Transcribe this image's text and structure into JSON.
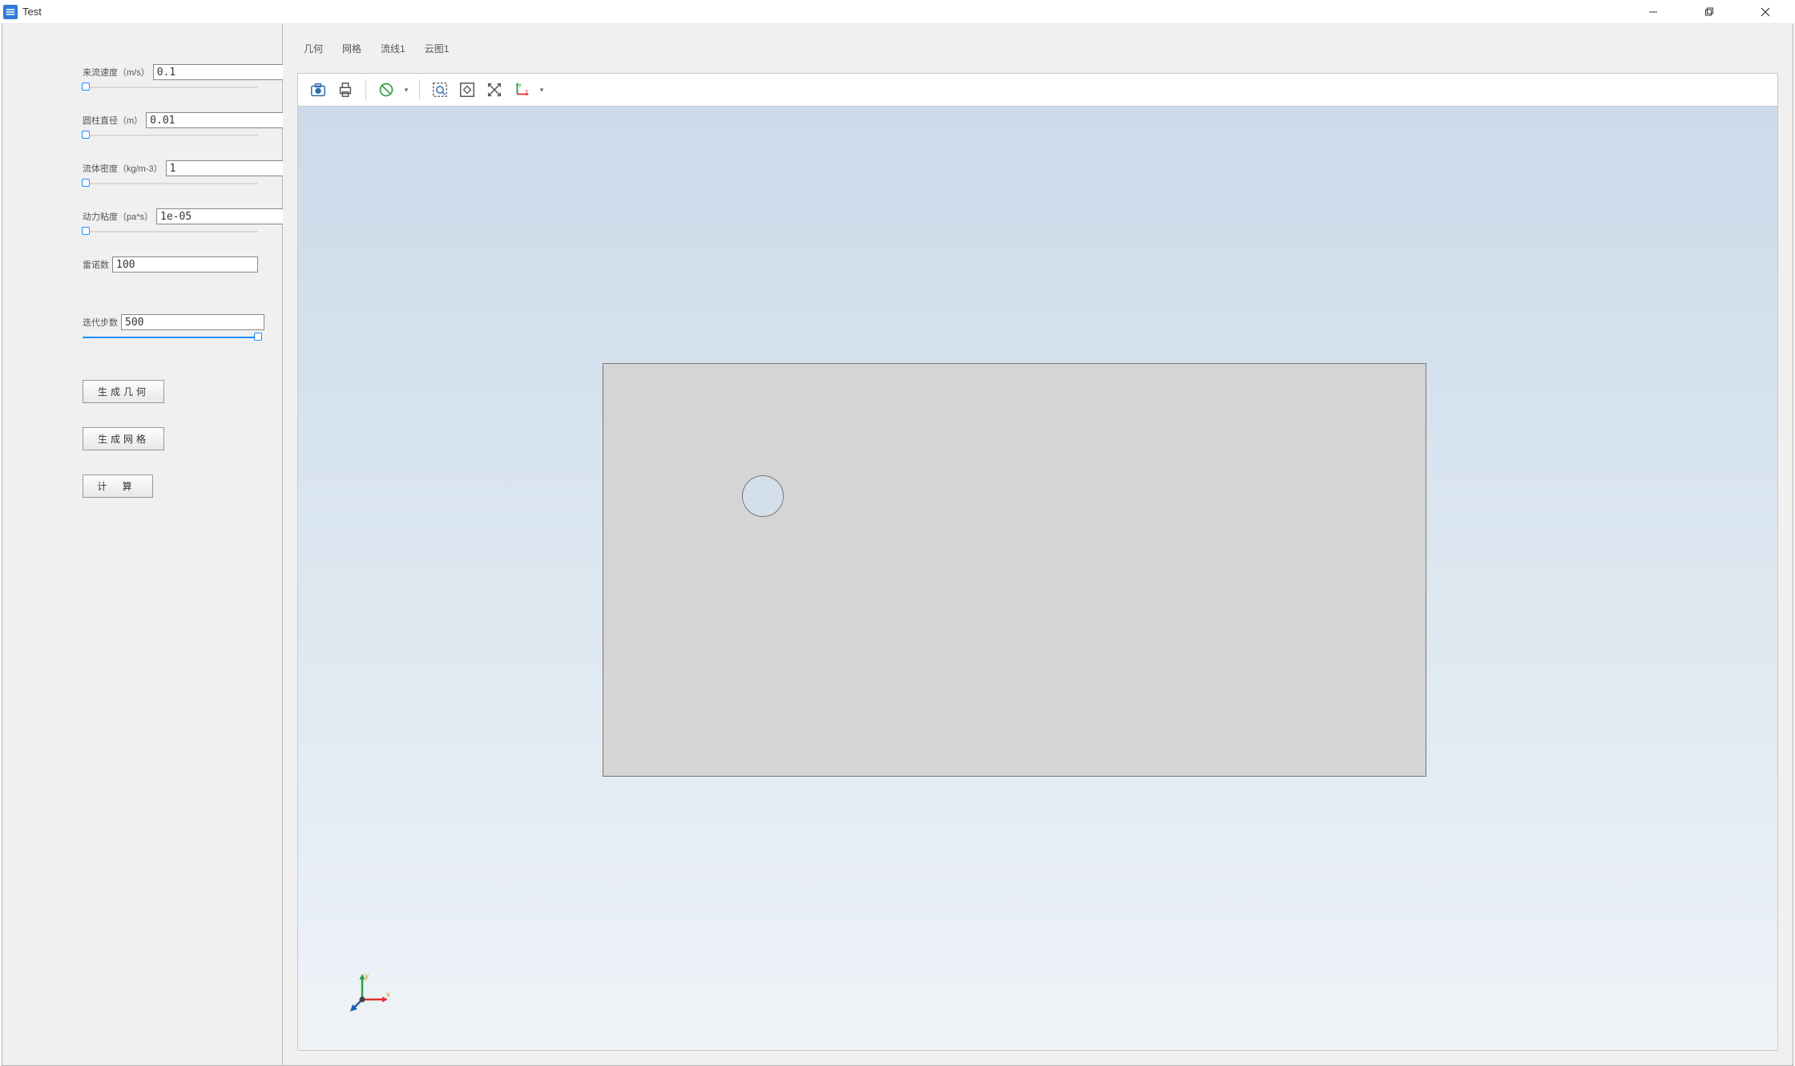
{
  "window": {
    "title": "Test"
  },
  "sidebar": {
    "params": {
      "velocity": {
        "label": "来流速度（m/s）",
        "value": "0.1",
        "slider_pct": 2
      },
      "diameter": {
        "label": "圆柱直径（m）",
        "value": "0.01",
        "slider_pct": 2
      },
      "density": {
        "label": "流体密度（kg/m-3）",
        "value": "1",
        "slider_pct": 2
      },
      "viscosity": {
        "label": "动力粘度（pa*s）",
        "value": "1e-05",
        "slider_pct": 2
      },
      "reynolds": {
        "label": "雷诺数",
        "value": "100",
        "slider_pct": 0
      },
      "iterations": {
        "label": "迭代步数",
        "value": "500",
        "slider_pct": 100
      }
    },
    "buttons": {
      "gen_geometry": "生成几何",
      "gen_mesh": "生成网格",
      "calculate": "计 算"
    }
  },
  "tabs": {
    "items": {
      "geometry": "几何",
      "mesh": "网格",
      "streamline1": "流线1",
      "contour1": "云图1"
    },
    "active": "geometry"
  },
  "toolbar": {
    "camera": "camera-icon",
    "print": "print-icon",
    "clear": "clear-icon",
    "zoom_box": "zoom-box-icon",
    "fit": "fit-icon",
    "reset": "reset-icon",
    "axes": "axes-icon"
  }
}
